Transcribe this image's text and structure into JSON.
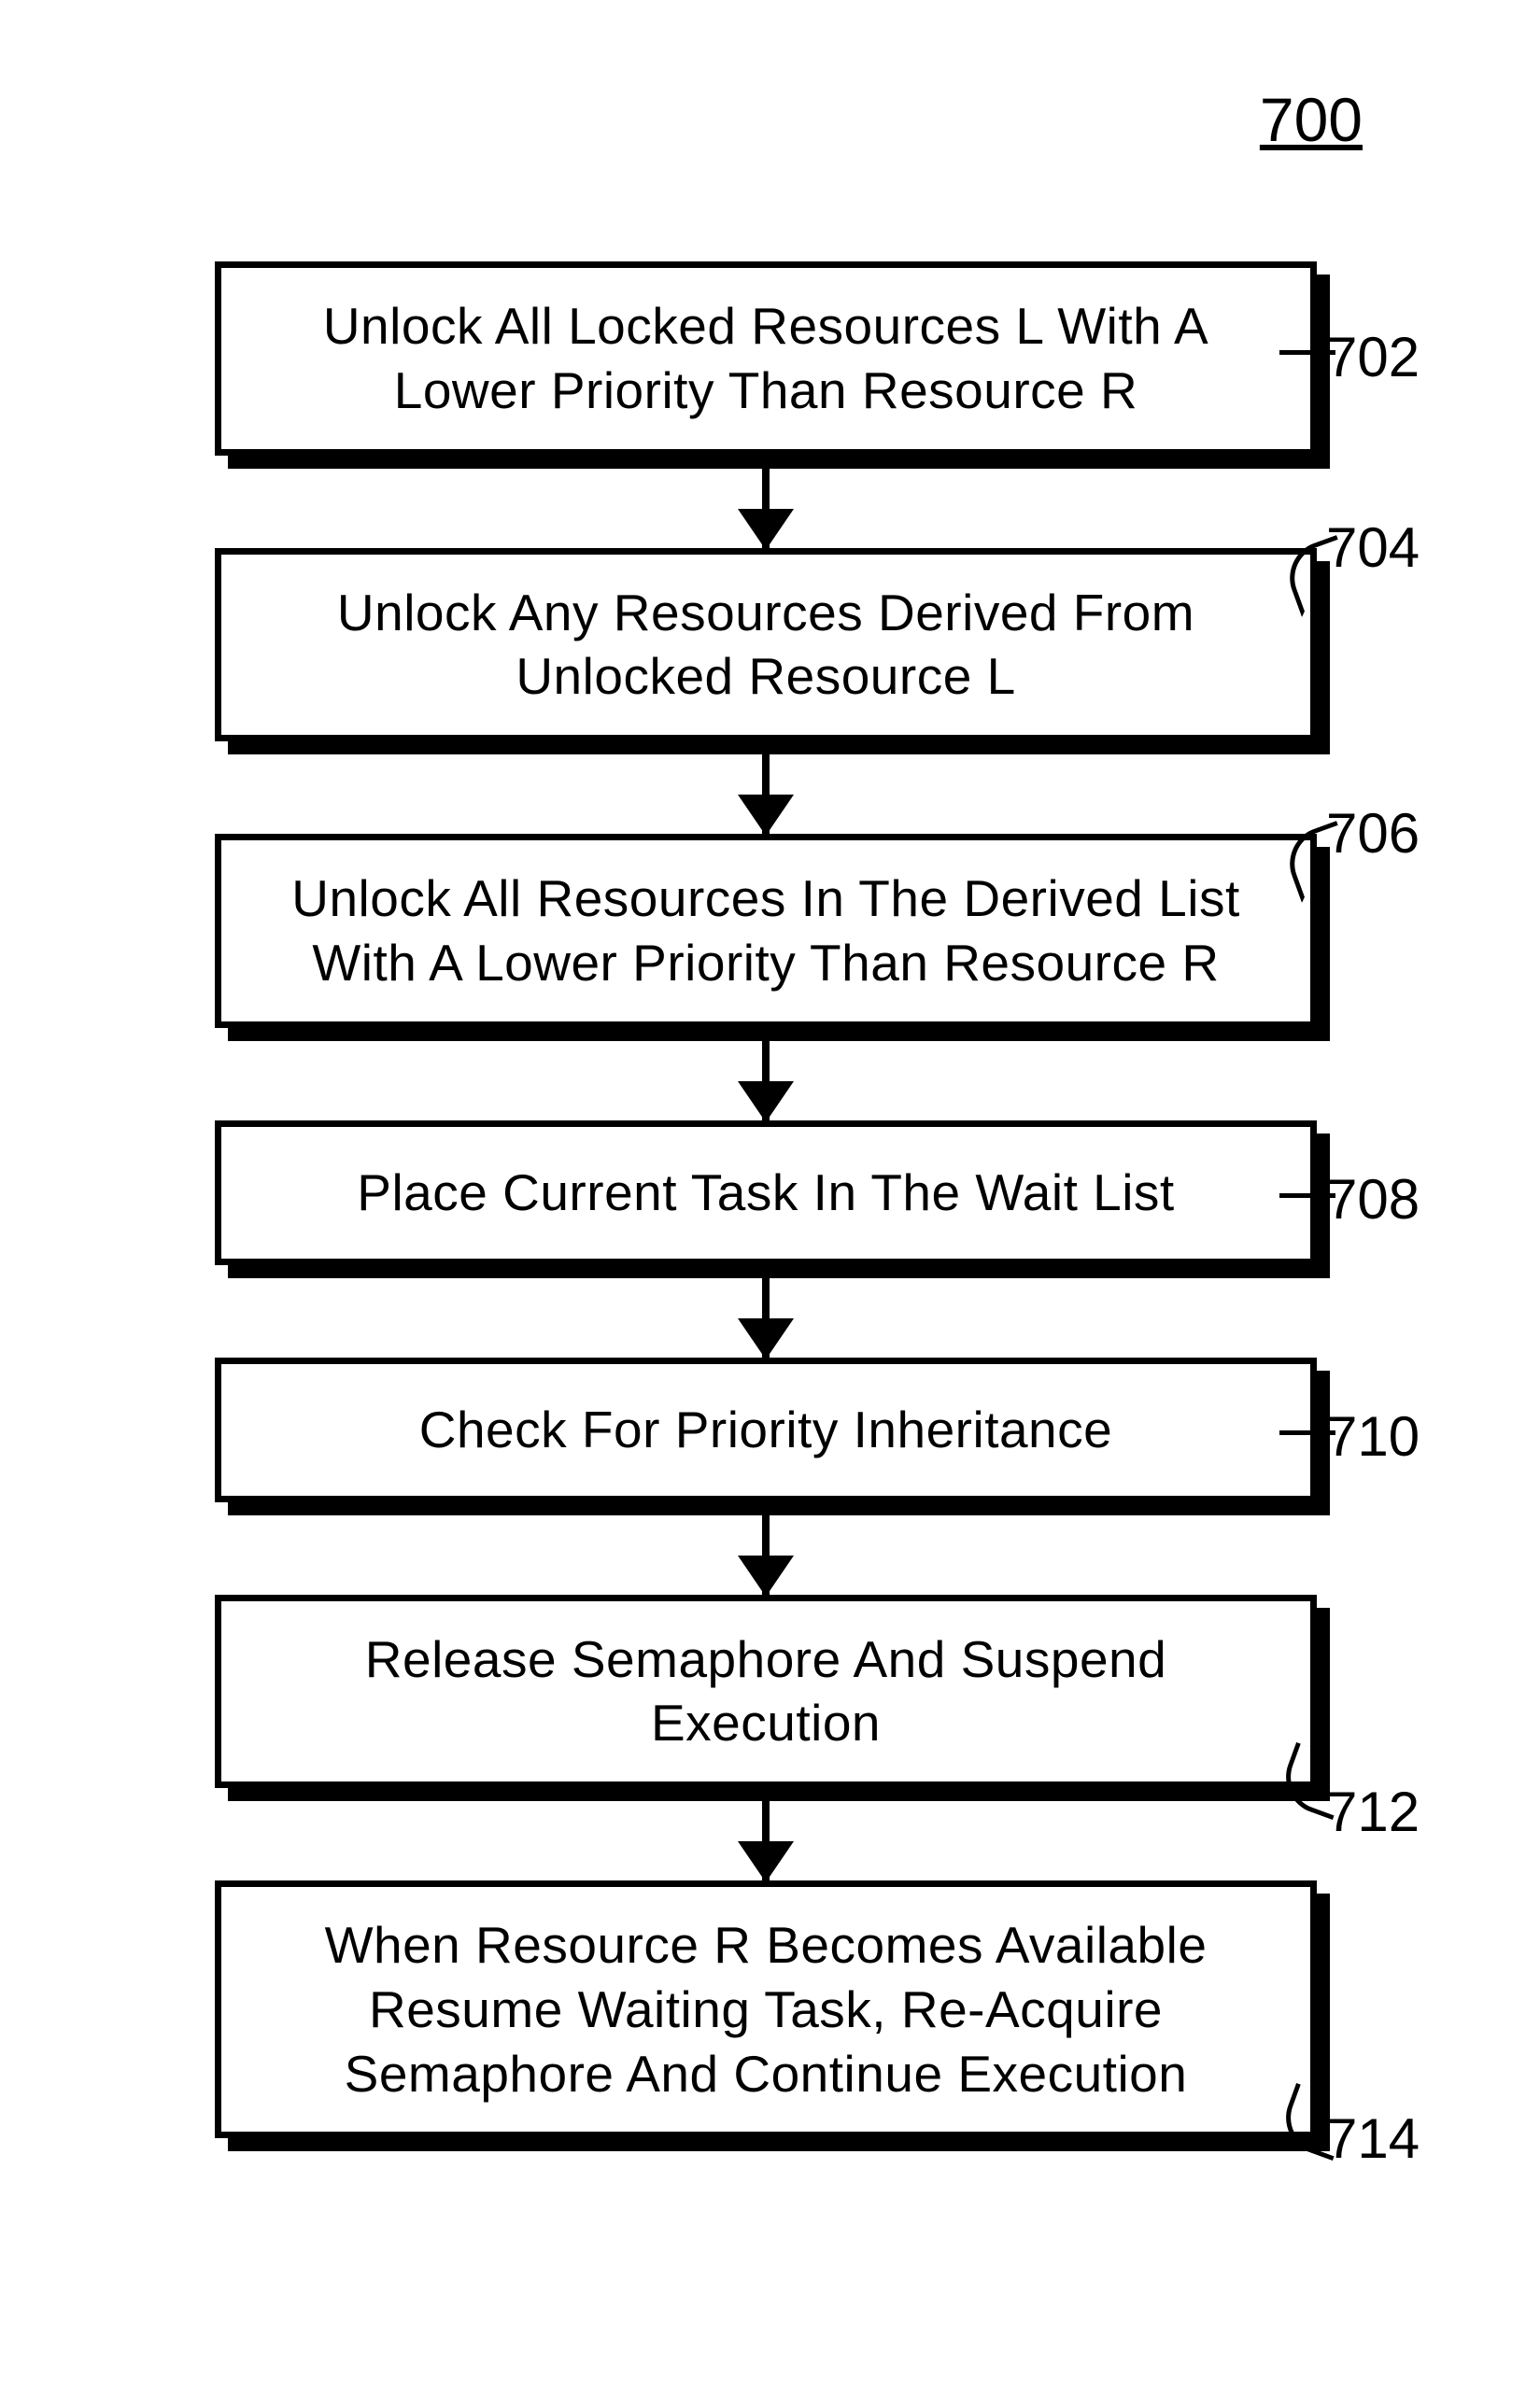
{
  "figure_number": "700",
  "steps": [
    {
      "ref": "702",
      "text": "Unlock All Locked Resources L With A Lower Priority Than Resource R"
    },
    {
      "ref": "704",
      "text": "Unlock Any Resources Derived From Unlocked Resource L"
    },
    {
      "ref": "706",
      "text": "Unlock All Resources In The Derived List With A Lower Priority Than Resource R"
    },
    {
      "ref": "708",
      "text": "Place Current Task In The Wait List"
    },
    {
      "ref": "710",
      "text": "Check For Priority Inheritance"
    },
    {
      "ref": "712",
      "text": "Release Semaphore And Suspend Execution"
    },
    {
      "ref": "714",
      "text": "When Resource R Becomes Available Resume Waiting Task, Re-Acquire Semaphore And Continue Execution"
    }
  ]
}
